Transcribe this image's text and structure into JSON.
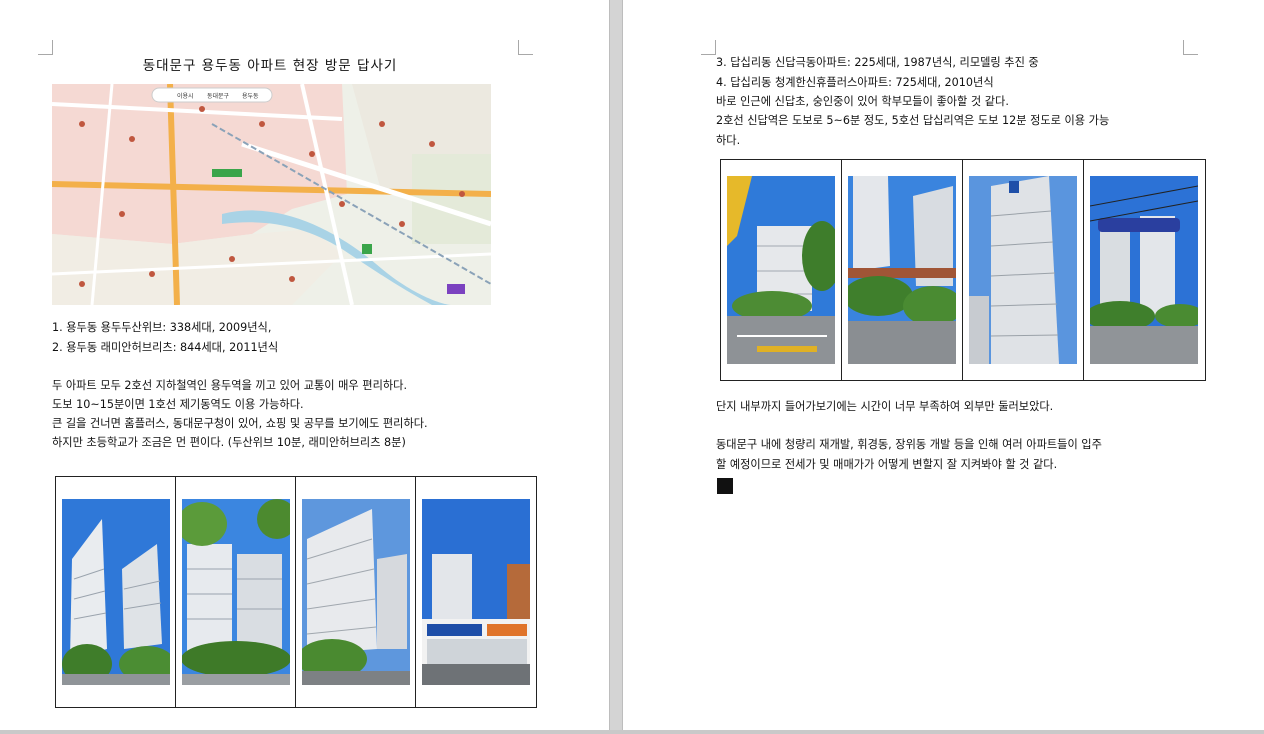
{
  "left_page": {
    "title": "동대문구 용두동 아파트 현장 방문 답사기",
    "map_labels": {
      "chip_1": "이용시",
      "chip_2": "동대문구",
      "chip_3": "용두동"
    },
    "list": [
      "1. 용두동 용두두산위브: 338세대, 2009년식,",
      "2. 용두동 래미안허브리츠: 844세대, 2011년식"
    ],
    "paragraph": [
      "두 아파트 모두 2호선 지하철역인 용두역을 끼고 있어 교통이 매우 편리하다.",
      "도보 10~15분이면 1호선 제기동역도 이용 가능하다.",
      "큰 길을 건너면 홈플러스, 동대문구청이 있어, 쇼핑 및 공무를 보기에도 편리하다.",
      "하지만 초등학교가 조금은 먼 편이다. (두산위브 10분, 래미안허브리츠 8분)"
    ],
    "photos": [
      "apartment-photo-1",
      "apartment-photo-2",
      "apartment-photo-3",
      "apartment-photo-4"
    ]
  },
  "right_page": {
    "list": [
      "3. 답십리동 신답극동아파트: 225세대, 1987년식, 리모델링 추진 중",
      "4. 답십리동 청계한신휴플러스아파트: 725세대, 2010년식"
    ],
    "paragraph1": [
      "바로 인근에 신답초, 숭인중이 있어 학부모들이 좋아할 것 같다.",
      "2호선 신답역은 도보로 5~6분 정도, 5호선 답십리역은 도보 12분 정도로 이용 가능",
      "하다."
    ],
    "paragraph2": "단지 내부까지 들어가보기에는 시간이 너무 부족하여 외부만 둘러보았다.",
    "paragraph3": [
      "동대문구 내에 청량리 재개발, 휘경동, 장위동 개발 등을 인해 여러 아파트들이 입주",
      "할 예정이므로 전세가 및 매매가가 어떻게 변할지 잘 지켜봐야 할 것 같다."
    ],
    "photos": [
      "apartment-photo-5",
      "apartment-photo-6",
      "apartment-photo-7",
      "apartment-photo-8"
    ]
  },
  "colors": {
    "page": "#ffffff",
    "background": "#d4d4d4",
    "map_pink": "#f5d9d3",
    "map_water": "#a9d3e6",
    "sky": "#2f78d8"
  }
}
